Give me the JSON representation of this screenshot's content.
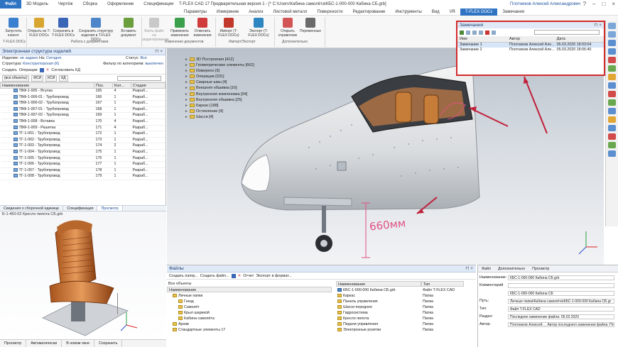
{
  "window": {
    "title": "T-FLEX CAD 17 Предварительная версия 1 - [* C:\\Users\\Кабина самолёта\\КБС-1-000-000 Кабина СБ.grb]",
    "user": "Плотников Алексей Александрович",
    "controls": [
      "?",
      "–",
      "□",
      "×"
    ]
  },
  "menu_tabs": [
    "Файл",
    "3D Модель",
    "Чертёж",
    "Сборка",
    "Оформление",
    "Спецификации",
    "Параметры",
    "Измерение",
    "Анализ",
    "Листовой металл",
    "Поверхности",
    "Редактирование",
    "Инструменты",
    "Вид",
    "VR",
    "T-FLEX DOCs",
    "Замечания"
  ],
  "ribbon": {
    "buttons": [
      {
        "label": "Запустить клиент"
      },
      {
        "label": "Открыть из T-FLEX DOCs"
      },
      {
        "label": "Сохранить в T-FLEX DOCs"
      },
      {
        "label": "Сохранить структуру изделия в T-FLEX DOCs"
      },
      {
        "label": "Вставить документ"
      },
      {
        "label": "Взять файл на редактирование"
      },
      {
        "label": "Применить изменения"
      },
      {
        "label": "Отменить изменения"
      },
      {
        "label": "Импорт (T-FLEX DOCs)"
      },
      {
        "label": "Экспорт (T-FLEX DOCs)"
      },
      {
        "label": "Открыть справочник"
      },
      {
        "label": "Переменные"
      }
    ],
    "groups": [
      "T-FLEX DOCs",
      "Работа с документами",
      "Изменение документов",
      "Импорт/Экспорт",
      "Дополнительно"
    ]
  },
  "structure_panel": {
    "title": "Электронная структура изделий",
    "izdelie_label": "Изделие:",
    "izdelie_value": "не задано",
    "na_label": "На:",
    "na_value": "Сегодня",
    "status_label": "Статус:",
    "status_value": "Все",
    "struktura_label": "Структура:",
    "struktura_value": "Конструкторская (К)",
    "filter_label": "Фильтр по категориям:",
    "filter_value": "выключен",
    "toolbar": [
      "Создать",
      "Операции",
      "Согласовать КД"
    ],
    "search_placeholder": "(все объекты)",
    "search_buttons": [
      "ФСИ",
      "КСИ",
      "КД"
    ],
    "columns": [
      "Наименование",
      "Поз.",
      "Кол...",
      "Стадия"
    ],
    "rows": [
      {
        "name": "ТВФ-1-005 - Втулка",
        "pos": "165",
        "qty": "4",
        "stage": "Разраб..."
      },
      {
        "name": "ТВФ-1-006-01 - Трубопровод",
        "pos": "166",
        "qty": "1",
        "stage": "Разраб..."
      },
      {
        "name": "ТВФ-1-006-02 - Трубопровод",
        "pos": "167",
        "qty": "1",
        "stage": "Разраб..."
      },
      {
        "name": "ТВФ-1-007-01 - Трубопровод",
        "pos": "168",
        "qty": "1",
        "stage": "Разраб..."
      },
      {
        "name": "ТВФ-1-007-02 - Трубопровод",
        "pos": "169",
        "qty": "1",
        "stage": "Разраб..."
      },
      {
        "name": "ТВФ-1-008 - Вставка",
        "pos": "170",
        "qty": "4",
        "stage": "Разраб..."
      },
      {
        "name": "ТВФ-1-009 - Решетка",
        "pos": "171",
        "qty": "4",
        "stage": "Разраб..."
      },
      {
        "name": "ТГ-1-001 - Трубопровод",
        "pos": "172",
        "qty": "1",
        "stage": "Разраб..."
      },
      {
        "name": "ТГ-1-002 - Трубопровод",
        "pos": "173",
        "qty": "1",
        "stage": "Разраб..."
      },
      {
        "name": "ТГ-1-003 - Трубопровод",
        "pos": "174",
        "qty": "2",
        "stage": "Разраб..."
      },
      {
        "name": "ТГ-1-004 - Трубопровод",
        "pos": "175",
        "qty": "1",
        "stage": "Разраб..."
      },
      {
        "name": "ТГ-1-005 - Трубопровод",
        "pos": "176",
        "qty": "1",
        "stage": "Разраб..."
      },
      {
        "name": "ТГ-1-006 - Трубопровод",
        "pos": "177",
        "qty": "1",
        "stage": "Разраб..."
      },
      {
        "name": "ТГ-1-007 - Трубопровод",
        "pos": "178",
        "qty": "1",
        "stage": "Разраб..."
      },
      {
        "name": "ТГ-1-008 - Трубопровод",
        "pos": "179",
        "qty": "1",
        "stage": "Разраб..."
      }
    ],
    "tabs": [
      "Сведения о сборочной единице",
      "Спецификация",
      "Просмотр"
    ],
    "preview_file": "Б-1-450-02 Кресло пилота СБ.grb",
    "bottom_buttons": [
      "Просмотр",
      "Автоматически",
      "В новом окне",
      "Сохранить"
    ]
  },
  "model_tree": {
    "items": [
      "3D Построения [412]",
      "Геометрические элементы [662]",
      "Измерено [5]",
      "Операции [331]",
      "Сварные швы [4]",
      "Внешняя обшивка [16]",
      "Внутренняя компоновка [94]",
      "Внутренняя обшивка [25]",
      "Каркас [188]",
      "Остекление [4]",
      "Шасси [4]"
    ]
  },
  "remarks_panel": {
    "title": "Замечания",
    "columns": [
      "Имя",
      "Автор",
      "Дата"
    ],
    "rows": [
      {
        "name": "Замечание 1",
        "author": "Плотников Алексей Але...",
        "date": "05.03.2020 18:03:04"
      },
      {
        "name": "Замечание 2",
        "author": "Плотников Алексей Але...",
        "date": "05.03.2020 18:06:40"
      }
    ]
  },
  "annotation_text": "660мм",
  "files_panel": {
    "title": "Файлы",
    "toolbar": [
      "Создать папку...",
      "Создать файл...",
      "Отчет",
      "Экспорт в формат..."
    ],
    "filter": "Все объекты",
    "tree_header": "Наименование",
    "tree": [
      "Личные папки",
      "Гнезд",
      "Самолёт",
      "Крыл шарикой",
      "Кабина самолёта",
      "Архив",
      "Стандартные элементы 17"
    ],
    "list_headers": [
      "Наименование",
      "Тип"
    ],
    "list": [
      {
        "name": "КБС-1-000-000 Кабина СБ.grb",
        "type": "Файл T-FLEX CAD"
      },
      {
        "name": "Каркас",
        "type": "Папка"
      },
      {
        "name": "Панель управления",
        "type": "Папка"
      },
      {
        "name": "Шасси переднее",
        "type": "Папка"
      },
      {
        "name": "Гидросистема",
        "type": "Папка"
      },
      {
        "name": "Кресло пилота",
        "type": "Папка"
      },
      {
        "name": "Педали управления",
        "type": "Папка"
      },
      {
        "name": "Электронные розетки",
        "type": "Папка"
      }
    ]
  },
  "props_panel": {
    "tabs": [
      "Файл",
      "Дополнительно",
      "Просмотр"
    ],
    "fields": [
      {
        "label": "Наименование:",
        "value": "КБС-1-000-000 Кабина СБ.grb"
      },
      {
        "label": "Комментарий",
        "value": ""
      },
      {
        "label": "",
        "value": "КБС-1-000-000 Кабина СБ"
      },
      {
        "label": "Путь:",
        "value": "Личные папки\\Кабина самолёта\\КБС-1-000-000 Кабина СБ.gr"
      },
      {
        "label": "Тип:",
        "value": "Файл T-FLEX CAD"
      },
      {
        "label": "Раздел:",
        "value": "Последнее изменение файла:  05.03.2020"
      },
      {
        "label": "Автор:",
        "value": "Плотников Алексей ...   Автор последнего изменения файла: Плотников"
      }
    ]
  },
  "colors": {
    "accent": "#2f73c3",
    "highlight_frame": "#d22b2b",
    "annotation": "#e05080"
  }
}
